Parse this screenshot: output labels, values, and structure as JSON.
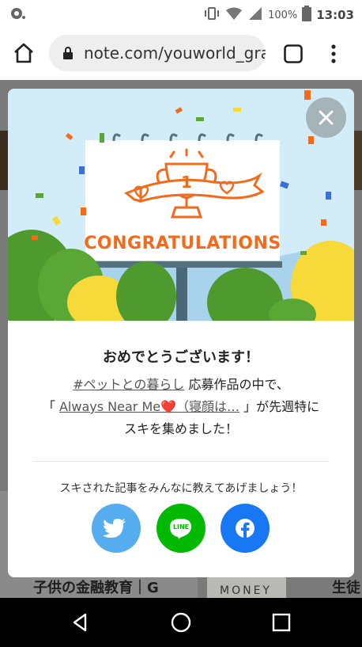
{
  "status_bar": {
    "battery_pct": "100%",
    "time": "13:03"
  },
  "browser": {
    "url": "note.com/youworld_grar"
  },
  "background_page": {
    "bottom_title_left": "子供の金融教育｜G",
    "money_label": "MONEY",
    "bottom_title_right": "生徒"
  },
  "modal": {
    "illustration": {
      "banner_text": "CONGRATULATIONS",
      "trophy_number": "1"
    },
    "title": "おめでとうございます！",
    "body": {
      "hashtag": "#ペットとの暮らし",
      "line1_suffix": " 応募作品の中で、",
      "quote_open": "「 ",
      "article_link": "Always Near Me❤️（寝顔は…",
      "quote_close": " 」が先週特に",
      "line3": "スキを集めました！"
    },
    "share_prompt": "スキされた記事をみんなに教えてあげましょう！",
    "share_buttons": [
      "twitter",
      "line",
      "facebook"
    ],
    "line_logo_text": "LINE"
  },
  "colors": {
    "twitter": "#55acee",
    "line": "#00b900",
    "facebook": "#1877f2",
    "banner_orange": "#f26b1d",
    "sky": "#d2ecf8"
  },
  "icons": [
    "home-icon",
    "lock-icon",
    "tabs-icon",
    "more-vert-icon",
    "close-icon",
    "twitter-icon",
    "line-icon",
    "facebook-icon",
    "back-icon",
    "home-nav-icon",
    "recents-icon"
  ]
}
